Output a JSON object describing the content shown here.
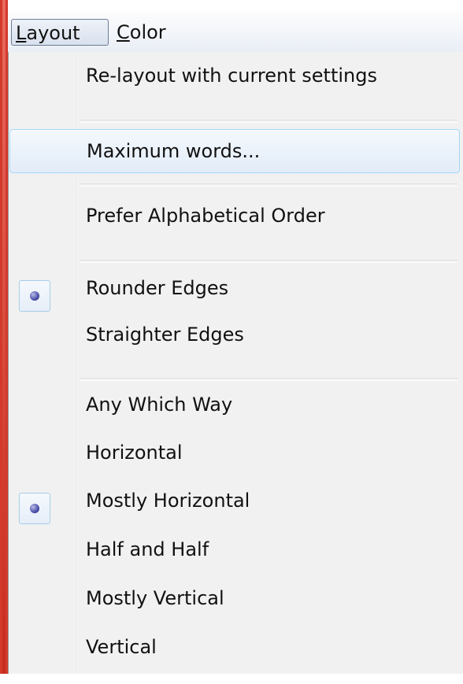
{
  "menubar": {
    "items": [
      {
        "label_hotkey": "L",
        "label_rest": "ayout"
      },
      {
        "label_hotkey": "C",
        "label_rest": "olor"
      }
    ]
  },
  "layout_menu": {
    "items": [
      {
        "label": "Re-layout with current settings"
      },
      {
        "label": "Maximum words..."
      },
      {
        "label": "Prefer Alphabetical Order"
      },
      {
        "label": "Rounder Edges"
      },
      {
        "label": "Straighter Edges"
      },
      {
        "label": "Any Which Way"
      },
      {
        "label": "Horizontal"
      },
      {
        "label": "Mostly Horizontal"
      },
      {
        "label": "Half and Half"
      },
      {
        "label": "Mostly Vertical"
      },
      {
        "label": "Vertical"
      }
    ]
  },
  "colors": {
    "menu_background": "#f1f1f1",
    "hover_border": "#a8d8f7",
    "radio_dot": "#4a4fa8"
  }
}
